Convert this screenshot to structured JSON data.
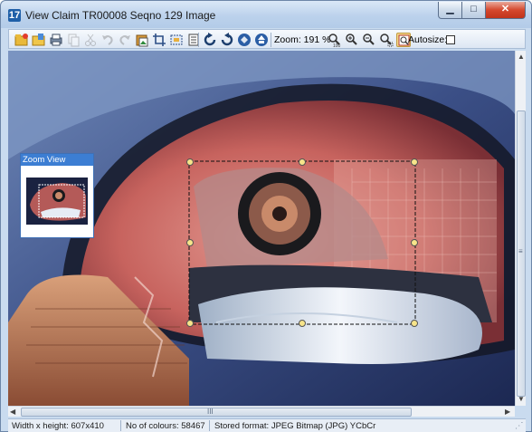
{
  "window": {
    "app_icon_text": "17",
    "title": "View Claim TR00008 Seqno 129 Image",
    "min_glyph": "▁",
    "max_glyph": "□",
    "close_glyph": "✕"
  },
  "toolbar": {
    "zoom_label": "Zoom: 191 %",
    "zoom_100_label": "100",
    "autosize_label": "Autosize:",
    "autosize_checked": false
  },
  "zoom_view": {
    "title": "Zoom View"
  },
  "status": {
    "dimensions": "Width x height: 607x410",
    "colours": "No of colours: 58467",
    "format": "Stored format: JPEG Bitmap (JPG) YCbCr"
  },
  "scroll": {
    "h_thumb_glyph": "III",
    "v_thumb_glyph": "≡"
  }
}
